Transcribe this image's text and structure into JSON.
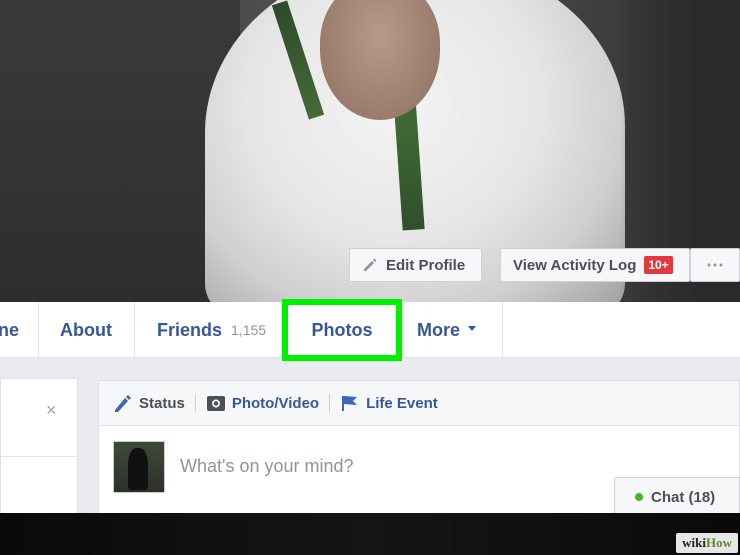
{
  "cover": {
    "edit_profile_label": "Edit Profile",
    "activity_log_label": "View Activity Log",
    "activity_badge": "10+",
    "more_label": "⋯"
  },
  "nav": {
    "timeline_partial": "ne",
    "about": "About",
    "friends": "Friends",
    "friends_count": "1,155",
    "photos": "Photos",
    "more": "More"
  },
  "composer": {
    "status": "Status",
    "photo_video": "Photo/Video",
    "life_event": "Life Event",
    "placeholder": "What's on your mind?"
  },
  "chat": {
    "label": "Chat (18)"
  },
  "close": "×",
  "watermark": {
    "wiki": "wiki",
    "how": "How"
  },
  "colors": {
    "link": "#365899",
    "highlight": "#00f000",
    "badge": "#e0393e",
    "online": "#42b72a"
  }
}
